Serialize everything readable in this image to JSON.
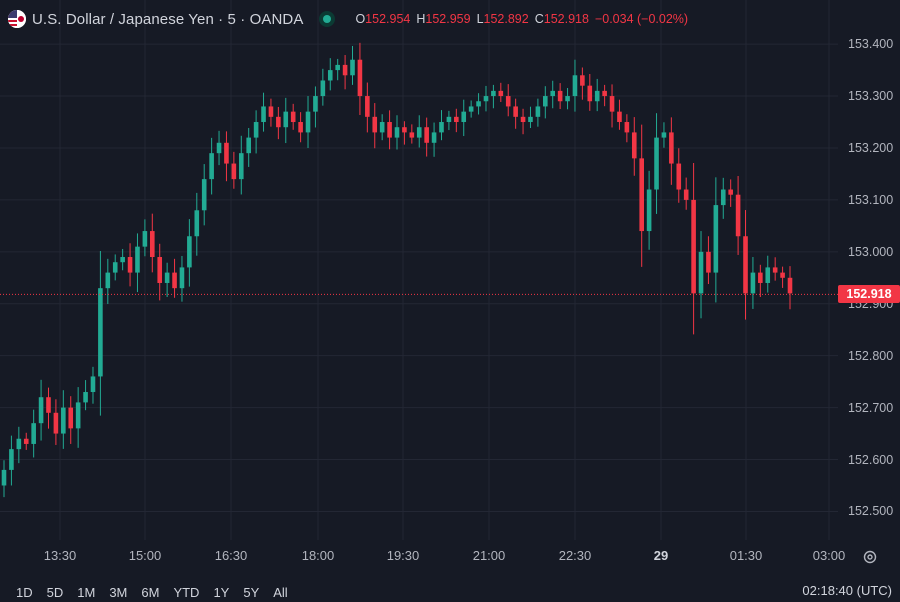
{
  "header": {
    "symbol_title": "U.S. Dollar / Japanese Yen · 5 · OANDA",
    "ohlc": [
      {
        "key": "O",
        "value": "152.954"
      },
      {
        "key": "H",
        "value": "152.959"
      },
      {
        "key": "L",
        "value": "152.892"
      },
      {
        "key": "C",
        "value": "152.918"
      },
      {
        "key": "",
        "value": "−0.034 (−0.02%)"
      }
    ]
  },
  "last_price": "152.918",
  "bottom_bar": {
    "ranges": [
      "1D",
      "5D",
      "1M",
      "3M",
      "6M",
      "YTD",
      "1Y",
      "5Y",
      "All"
    ],
    "clock": "02:18:40 (UTC)"
  },
  "colors": {
    "background": "#161a25",
    "up": "#22ab94",
    "down": "#f23645",
    "grid": "#232734",
    "text": "#b2b5be"
  },
  "chart_data": {
    "type": "candlestick",
    "interval_minutes": 5,
    "x_tick_labels": [
      "13:30",
      "15:00",
      "16:30",
      "18:00",
      "19:30",
      "21:00",
      "22:30",
      "29",
      "01:30",
      "03:00"
    ],
    "y_tick_labels": [
      "153.400",
      "153.300",
      "153.200",
      "153.100",
      "153.000",
      "152.900",
      "152.800",
      "152.700",
      "152.600",
      "152.500"
    ],
    "ylim": [
      152.445,
      153.485
    ],
    "last_price": 152.918,
    "grid": true,
    "closes": [
      152.58,
      152.62,
      152.64,
      152.63,
      152.67,
      152.72,
      152.69,
      152.65,
      152.7,
      152.66,
      152.71,
      152.73,
      152.76,
      152.93,
      152.96,
      152.98,
      152.99,
      152.96,
      153.01,
      153.04,
      152.99,
      152.94,
      152.96,
      152.93,
      152.97,
      153.03,
      153.08,
      153.14,
      153.19,
      153.21,
      153.17,
      153.14,
      153.19,
      153.22,
      153.25,
      153.28,
      153.26,
      153.24,
      153.27,
      153.25,
      153.23,
      153.27,
      153.3,
      153.33,
      153.35,
      153.36,
      153.34,
      153.37,
      153.3,
      153.26,
      153.23,
      153.25,
      153.22,
      153.24,
      153.23,
      153.22,
      153.24,
      153.21,
      153.23,
      153.25,
      153.26,
      153.25,
      153.27,
      153.28,
      153.29,
      153.3,
      153.31,
      153.3,
      153.28,
      153.26,
      153.25,
      153.26,
      153.28,
      153.3,
      153.31,
      153.29,
      153.3,
      153.34,
      153.32,
      153.29,
      153.31,
      153.3,
      153.27,
      153.25,
      153.23,
      153.18,
      153.04,
      153.12,
      153.22,
      153.23,
      153.17,
      153.12,
      153.1,
      152.92,
      153.0,
      152.96,
      153.09,
      153.12,
      153.11,
      153.03,
      152.92,
      152.96,
      152.94,
      152.97,
      152.96,
      152.95,
      152.92
    ],
    "open": 152.55
  }
}
